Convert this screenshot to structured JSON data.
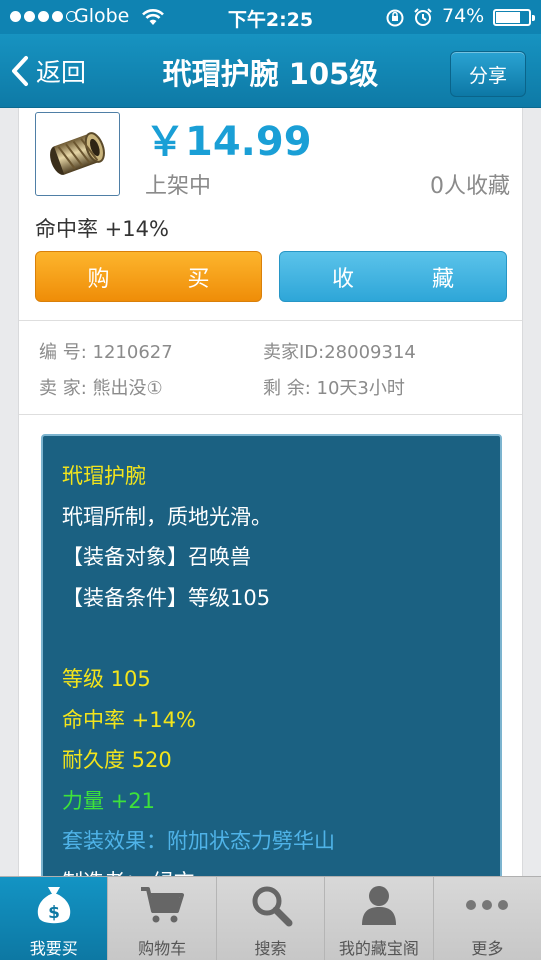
{
  "status_bar": {
    "carrier": "Globe",
    "time": "下午2:25",
    "battery_percent": "74%",
    "battery_level": 0.74
  },
  "nav": {
    "back_label": "返回",
    "title": "玳瑁护腕 105级",
    "share_label": "分享"
  },
  "item": {
    "price": "￥14.99",
    "listing_status": "上架中",
    "favorites": "0人收藏",
    "attribute": "命中率 +14%",
    "buy_label": "购　买",
    "collect_label": "收　藏"
  },
  "info": {
    "number_key": "编 号:",
    "number_value": "1210627",
    "seller_id_key": "卖家ID:",
    "seller_id_value": "28009314",
    "seller_key": "卖 家:",
    "seller_value": "熊出没①",
    "remaining_key": "剩 余:",
    "remaining_value": "10天3小时"
  },
  "description": {
    "lines": [
      {
        "text": "玳瑁护腕",
        "color": "#f3e41c"
      },
      {
        "text": "玳瑁所制，质地光滑。",
        "color": "#ffffff"
      },
      {
        "text": "【装备对象】召唤兽",
        "color": "#ffffff"
      },
      {
        "text": "【装备条件】等级105",
        "color": "#ffffff"
      },
      {
        "text": "",
        "color": "#ffffff"
      },
      {
        "text": "等级 105",
        "color": "#f3e41c"
      },
      {
        "text": "命中率 +14%",
        "color": "#f3e41c"
      },
      {
        "text": "耐久度 520",
        "color": "#f3e41c"
      },
      {
        "text": "力量 +21",
        "color": "#3ee23a"
      },
      {
        "text": "套装效果：附加状态力劈华山",
        "color": "#4fb3e8"
      },
      {
        "text": "制造者： 绿衣",
        "color": "#ffffff"
      }
    ]
  },
  "tabs": [
    {
      "label": "我要买",
      "icon": "money-bag-icon",
      "active": true
    },
    {
      "label": "购物车",
      "icon": "cart-icon",
      "active": false
    },
    {
      "label": "搜索",
      "icon": "search-icon",
      "active": false
    },
    {
      "label": "我的藏宝阁",
      "icon": "person-icon",
      "active": false
    },
    {
      "label": "更多",
      "icon": "more-icon",
      "active": false
    }
  ]
}
